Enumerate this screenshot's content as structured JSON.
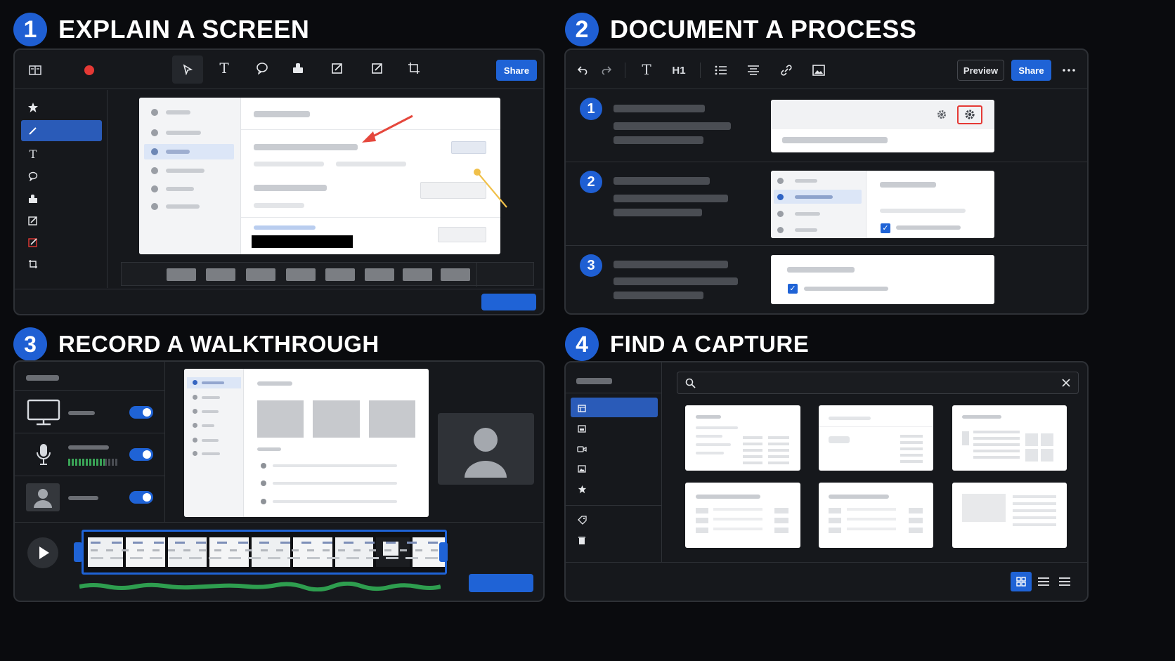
{
  "sections": [
    {
      "number": "1",
      "title": "EXPLAIN A SCREEN"
    },
    {
      "number": "2",
      "title": "DOCUMENT A PROCESS"
    },
    {
      "number": "3",
      "title": "RECORD A WALKTHROUGH"
    },
    {
      "number": "4",
      "title": "FIND A CAPTURE"
    }
  ],
  "explain": {
    "share_label": "Share",
    "toolbar_icons": [
      "layout-icon",
      "record-icon",
      "arrow-tool-icon",
      "text-tool-icon",
      "speech-bubble-icon",
      "stamp-icon",
      "edit-icon",
      "edit-icon",
      "crop-icon"
    ],
    "side_icons": [
      "star-icon",
      "pen-icon",
      "text-icon",
      "speech-bubble-icon",
      "stamp-icon",
      "edit-icon",
      "highlight-edit-icon",
      "crop-icon"
    ],
    "record_color": "#e53935",
    "arrow_color": "#e5473c",
    "pointer_color": "#f0c04a"
  },
  "document": {
    "preview_label": "Preview",
    "share_label": "Share",
    "h1_label": "H1",
    "steps": [
      "1",
      "2",
      "3"
    ],
    "highlight_color": "#e53935"
  },
  "walkthrough": {
    "sources": [
      "screen",
      "microphone",
      "camera"
    ],
    "toggles_on": [
      true,
      true,
      true
    ],
    "waveform_color": "#2e9e4f"
  },
  "capture": {
    "nav_icons": [
      "screen-icon",
      "image-icon",
      "video-icon",
      "picture-icon",
      "star-icon",
      "tag-icon",
      "trash-icon"
    ],
    "view_modes": [
      "grid-view-icon",
      "list-view-icon",
      "compact-list-icon"
    ]
  },
  "colors": {
    "accent": "#1f63d6",
    "background": "#0a0b0e",
    "panel": "#16181c"
  }
}
